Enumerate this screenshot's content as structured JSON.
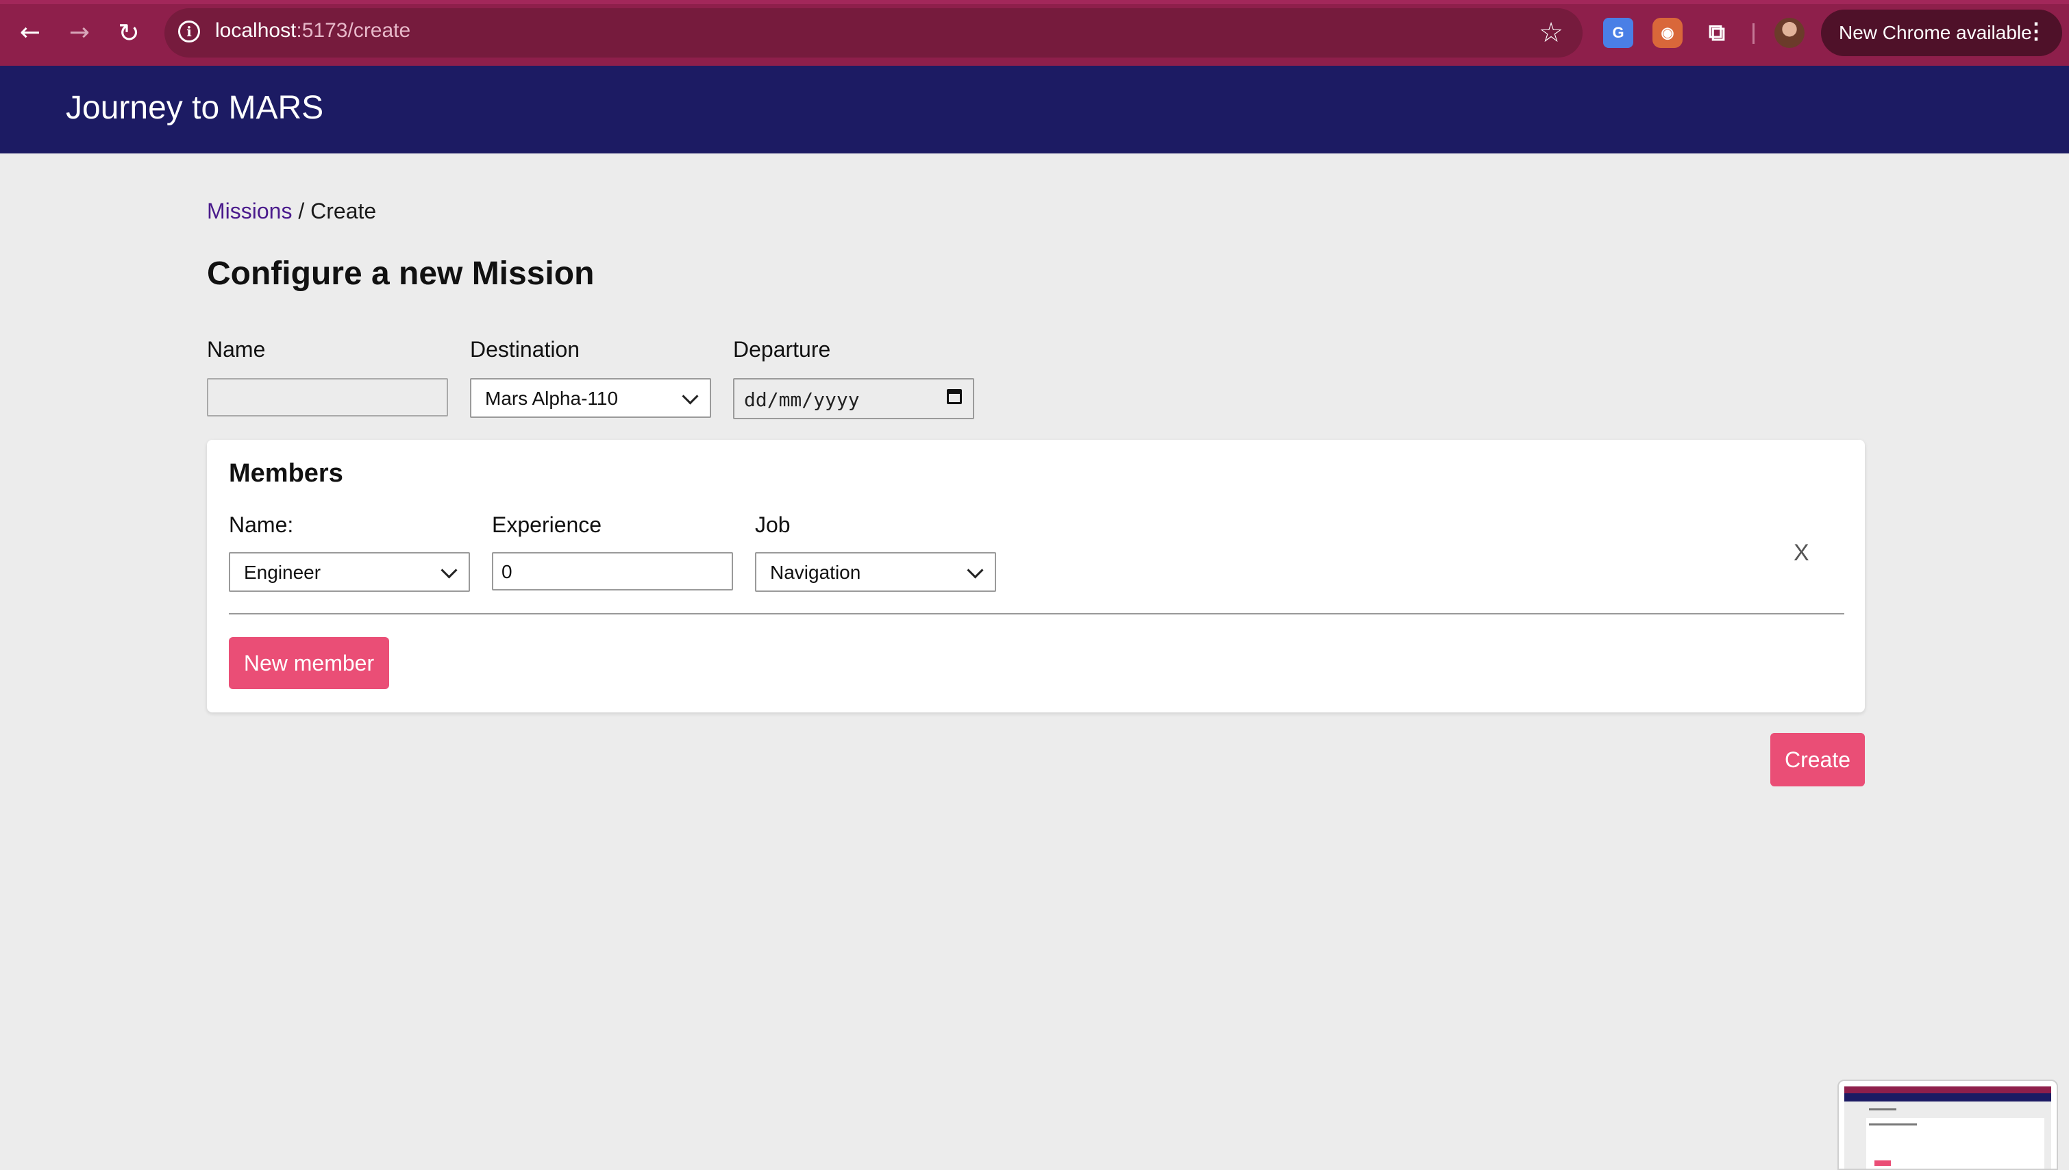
{
  "browser": {
    "url_host": "localhost",
    "url_path": ":5173/create",
    "update_label": "New Chrome available",
    "icons": {
      "back": "arrow-left",
      "forward": "arrow-right",
      "reload": "reload",
      "info": "info",
      "bookmark": "star",
      "translate": "google-translate-extension",
      "extension": "fox-extension",
      "extensions_menu": "puzzle",
      "profile": "avatar",
      "menu": "kebab"
    },
    "colors": {
      "tab_strip": "#8e1f4b",
      "omnibox": "#761b3d"
    }
  },
  "header": {
    "title": "Journey to MARS"
  },
  "breadcrumb": {
    "link": "Missions",
    "separator": " / ",
    "current": "Create"
  },
  "page": {
    "title": "Configure a new Mission"
  },
  "form": {
    "name_label": "Name",
    "name_value": "",
    "destination_label": "Destination",
    "destination_value": "Mars Alpha-110",
    "departure_label": "Departure",
    "departure_placeholder": "dd/mm/yyyy"
  },
  "members": {
    "title": "Members",
    "name_label": "Name:",
    "experience_label": "Experience",
    "job_label": "Job",
    "rows": [
      {
        "name": "Engineer",
        "experience": "0",
        "job": "Navigation",
        "remove": "X"
      }
    ],
    "new_member_label": "New member"
  },
  "actions": {
    "create_label": "Create"
  },
  "colors": {
    "header_bg": "#1c1b63",
    "accent_button": "#ea4e76",
    "link": "#4a1b8c",
    "page_bg": "#ececec"
  }
}
